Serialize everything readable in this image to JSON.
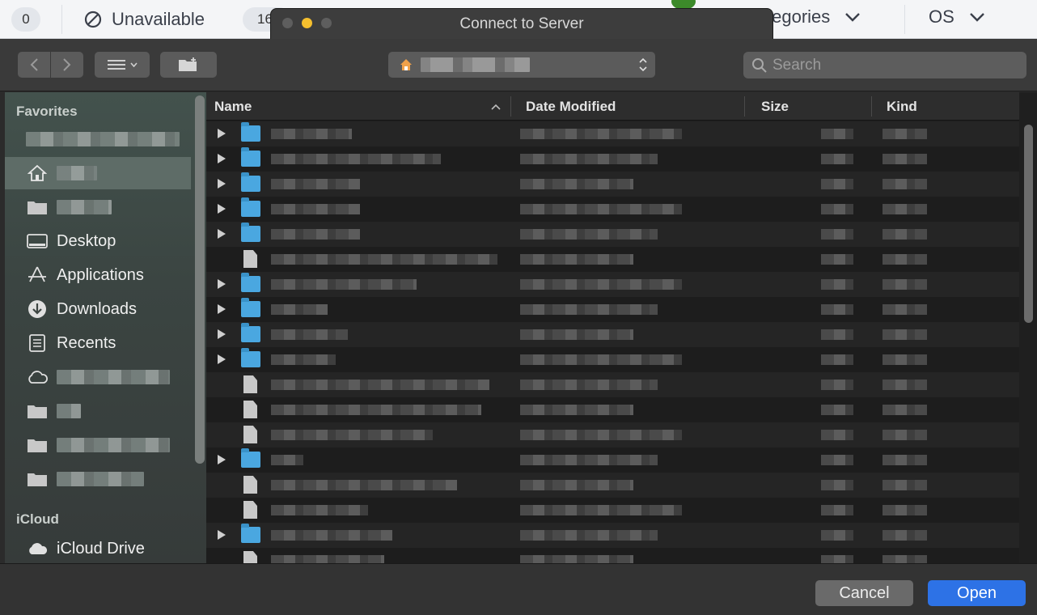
{
  "background_page": {
    "count_badge": "0",
    "unavailable_label": "Unavailable",
    "count_badge_2": "16",
    "categories_label": "tegories",
    "os_label": "OS"
  },
  "window": {
    "title": "Connect to Server"
  },
  "toolbar": {
    "back_icon": "chevron-left-icon",
    "forward_icon": "chevron-right-icon",
    "view_icon": "list-view-icon",
    "new_folder_icon": "new-folder-icon",
    "path_icon": "home-icon"
  },
  "search": {
    "placeholder": "Search"
  },
  "sidebar": {
    "favorites_heading": "Favorites",
    "icloud_heading": "iCloud",
    "items": [
      {
        "label": "Desktop",
        "icon": "desktop-icon"
      },
      {
        "label": "Applications",
        "icon": "applications-icon"
      },
      {
        "label": "Downloads",
        "icon": "downloads-icon"
      },
      {
        "label": "Recents",
        "icon": "recents-icon"
      }
    ],
    "icloud_drive": {
      "label": "iCloud Drive",
      "icon": "cloud-icon"
    }
  },
  "columns": {
    "name": "Name",
    "date_modified": "Date Modified",
    "size": "Size",
    "kind": "Kind",
    "sort_indicator": "^"
  },
  "buttons": {
    "cancel": "Cancel",
    "open": "Open"
  },
  "colors": {
    "accent": "#2d72e6",
    "folder": "#4aa7e0"
  }
}
